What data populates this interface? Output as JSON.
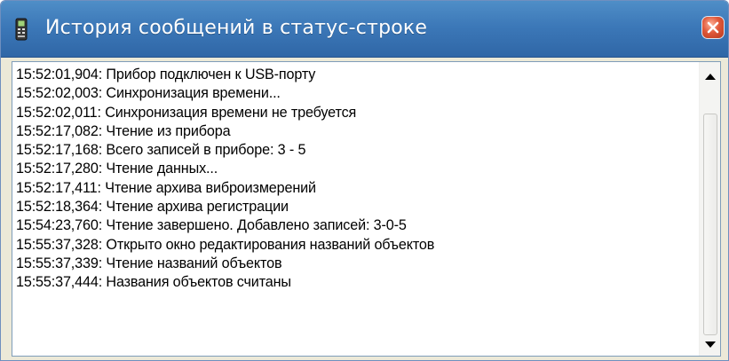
{
  "window": {
    "title": "История сообщений в статус-строке",
    "app_icon": "phone-device-icon",
    "close_icon": "close-icon"
  },
  "log": {
    "lines": [
      "15:52:01,904: Прибор подключен к USB-порту",
      "15:52:02,003: Синхронизация времени...",
      "15:52:02,011: Синхронизация времени не требуется",
      "15:52:17,082: Чтение из прибора",
      "15:52:17,168: Всего записей в приборе: 3 - 5",
      "15:52:17,280: Чтение данных...",
      "15:52:17,411: Чтение архива виброизмерений",
      "15:52:18,364: Чтение архива регистрации",
      "15:54:23,760: Чтение завершено. Добавлено записей: 3-0-5",
      "15:55:37,328: Открыто окно редактирования названий объектов",
      "15:55:37,339: Чтение названий объектов",
      "15:55:37,444: Названия объектов считаны"
    ]
  },
  "scrollbar": {
    "up_icon": "scroll-up-arrow-icon",
    "down_icon": "scroll-down-arrow-icon"
  },
  "colors": {
    "titlebar": "#3c78b8",
    "title_text": "#ffffff",
    "close_button": "#e0583a",
    "window_face": "#ece9d8",
    "list_border": "#7f9db9"
  }
}
